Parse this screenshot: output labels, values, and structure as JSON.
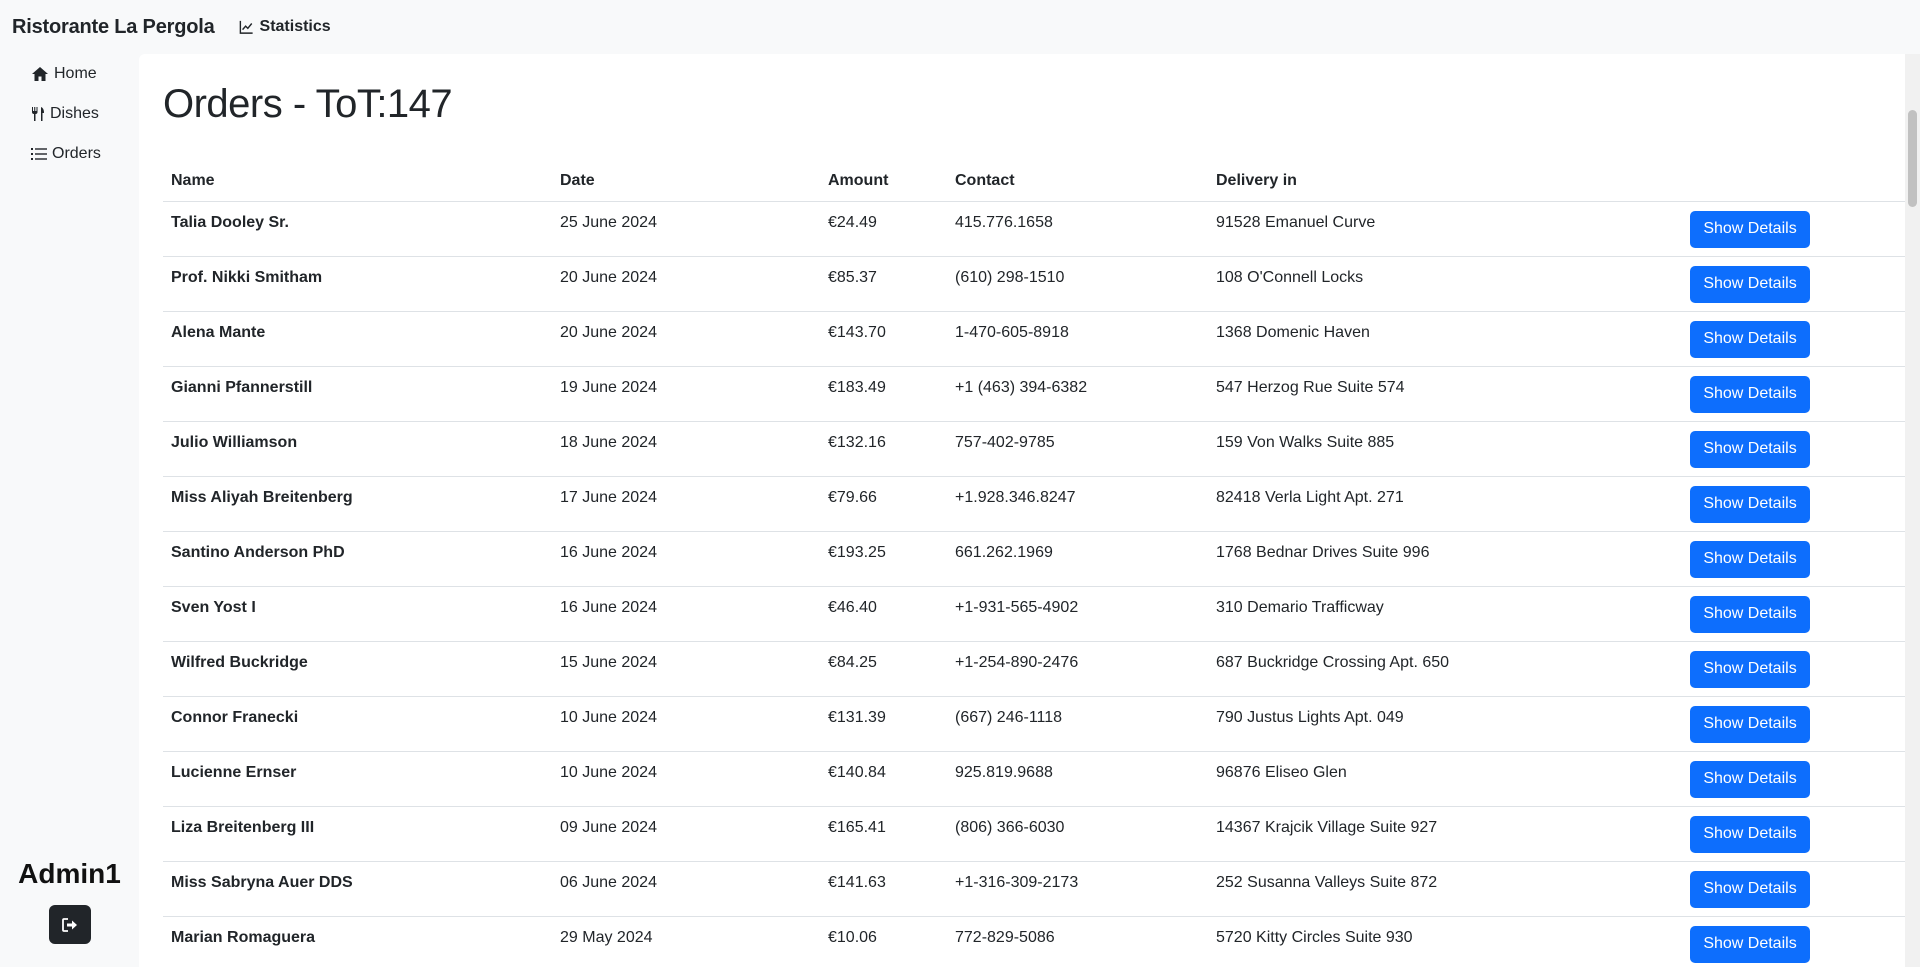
{
  "app": {
    "brand": "Ristorante La Pergola",
    "top_nav": {
      "statistics_label": "Statistics"
    }
  },
  "sidebar": {
    "items": [
      {
        "label": "Home",
        "icon": "home-icon"
      },
      {
        "label": "Dishes",
        "icon": "utensils-icon"
      },
      {
        "label": "Orders",
        "icon": "list-icon"
      }
    ],
    "user": "Admin1",
    "logout_icon": "logout-icon"
  },
  "main": {
    "title": "Orders - ToT:147",
    "table": {
      "headers": [
        "Name",
        "Date",
        "Amount",
        "Contact",
        "Delivery in",
        ""
      ],
      "button_label": "Show Details",
      "rows": [
        {
          "name": "Talia Dooley Sr.",
          "date": "25 June 2024",
          "amount": "€24.49",
          "contact": "415.776.1658",
          "delivery": "91528 Emanuel Curve"
        },
        {
          "name": "Prof. Nikki Smitham",
          "date": "20 June 2024",
          "amount": "€85.37",
          "contact": "(610) 298-1510",
          "delivery": "108 O'Connell Locks"
        },
        {
          "name": "Alena Mante",
          "date": "20 June 2024",
          "amount": "€143.70",
          "contact": "1-470-605-8918",
          "delivery": "1368 Domenic Haven"
        },
        {
          "name": "Gianni Pfannerstill",
          "date": "19 June 2024",
          "amount": "€183.49",
          "contact": "+1 (463) 394-6382",
          "delivery": "547 Herzog Rue Suite 574"
        },
        {
          "name": "Julio Williamson",
          "date": "18 June 2024",
          "amount": "€132.16",
          "contact": "757-402-9785",
          "delivery": "159 Von Walks Suite 885"
        },
        {
          "name": "Miss Aliyah Breitenberg",
          "date": "17 June 2024",
          "amount": "€79.66",
          "contact": "+1.928.346.8247",
          "delivery": "82418 Verla Light Apt. 271"
        },
        {
          "name": "Santino Anderson PhD",
          "date": "16 June 2024",
          "amount": "€193.25",
          "contact": "661.262.1969",
          "delivery": "1768 Bednar Drives Suite 996"
        },
        {
          "name": "Sven Yost I",
          "date": "16 June 2024",
          "amount": "€46.40",
          "contact": "+1-931-565-4902",
          "delivery": "310 Demario Trafficway"
        },
        {
          "name": "Wilfred Buckridge",
          "date": "15 June 2024",
          "amount": "€84.25",
          "contact": "+1-254-890-2476",
          "delivery": "687 Buckridge Crossing Apt. 650"
        },
        {
          "name": "Connor Franecki",
          "date": "10 June 2024",
          "amount": "€131.39",
          "contact": "(667) 246-1118",
          "delivery": "790 Justus Lights Apt. 049"
        },
        {
          "name": "Lucienne Ernser",
          "date": "10 June 2024",
          "amount": "€140.84",
          "contact": "925.819.9688",
          "delivery": "96876 Eliseo Glen"
        },
        {
          "name": "Liza Breitenberg III",
          "date": "09 June 2024",
          "amount": "€165.41",
          "contact": "(806) 366-6030",
          "delivery": "14367 Krajcik Village Suite 927"
        },
        {
          "name": "Miss Sabryna Auer DDS",
          "date": "06 June 2024",
          "amount": "€141.63",
          "contact": "+1-316-309-2173",
          "delivery": "252 Susanna Valleys Suite 872"
        },
        {
          "name": "Marian Romaguera",
          "date": "29 May 2024",
          "amount": "€10.06",
          "contact": "772-829-5086",
          "delivery": "5720 Kitty Circles Suite 930"
        }
      ]
    }
  },
  "colors": {
    "primary_button": "#0d6efd",
    "page_bg": "#f8f9fa",
    "content_bg": "#ffffff",
    "logout_button": "#212529"
  }
}
